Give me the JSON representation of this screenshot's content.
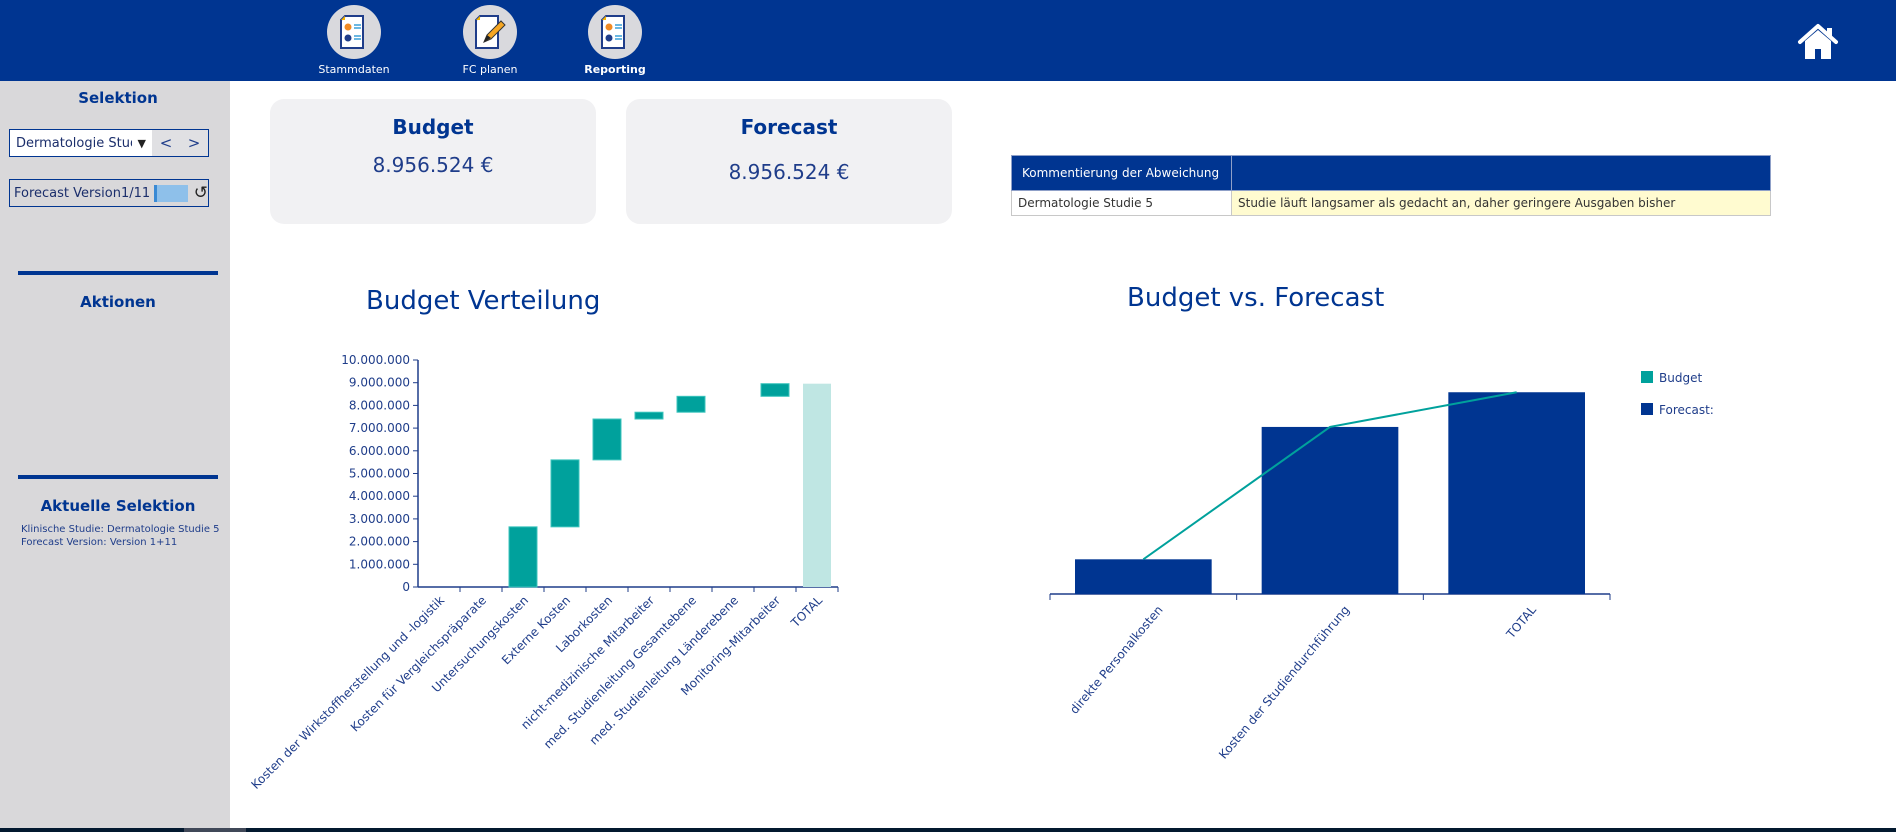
{
  "topnav": {
    "items": [
      {
        "label": "Stammdaten",
        "icon": "report-document-icon",
        "active": false
      },
      {
        "label": "FC planen",
        "icon": "edit-document-icon",
        "active": false
      },
      {
        "label": "Reporting",
        "icon": "report-document-icon",
        "active": true
      }
    ],
    "home_icon": "home-icon"
  },
  "sidebar": {
    "selektion_title": "Selektion",
    "study_dropdown": {
      "value": "Dermatologie Studie",
      "prev": "<",
      "next": ">"
    },
    "version_selector": {
      "label": "Forecast Version",
      "value": "1/11"
    },
    "aktionen_title": "Aktionen",
    "aktuelle_selektion_title": "Aktuelle Selektion",
    "aktuelle_selektion_lines": [
      "Klinische Studie: Dermatologie Studie 5",
      "Forecast Version: Version 1+11"
    ]
  },
  "kpis": {
    "budget": {
      "title": "Budget",
      "value": "8.956.524 €"
    },
    "forecast": {
      "title": "Forecast",
      "value": "8.956.524 €"
    }
  },
  "comment_table": {
    "header": [
      "Kommentierung der Abweichung",
      ""
    ],
    "rows": [
      [
        "Dermatologie Studie 5",
        "Studie läuft langsamer als gedacht an, daher geringere Ausgaben bisher"
      ]
    ]
  },
  "colors": {
    "navy": "#003591",
    "teal": "#00a19c",
    "total_teal": "#bfe6e3"
  },
  "chart_data": [
    {
      "type": "bar",
      "subtype": "waterfall",
      "title": "Budget Verteilung",
      "xlabel": "",
      "ylabel": "",
      "ylim": [
        0,
        10000000
      ],
      "yticks": [
        0,
        1000000,
        2000000,
        3000000,
        4000000,
        5000000,
        6000000,
        7000000,
        8000000,
        9000000,
        10000000
      ],
      "ytick_labels": [
        "0",
        "1.000.000",
        "2.000.000",
        "3.000.000",
        "4.000.000",
        "5.000.000",
        "6.000.000",
        "7.000.000",
        "8.000.000",
        "9.000.000",
        "10.000.000"
      ],
      "categories": [
        "Kosten der Wirkstoffherstellung und -logistik",
        "Kosten für Vergleichspräparate",
        "Untersuchungskosten",
        "Externe Kosten",
        "Laborkosten",
        "nicht-medizinische Mitarbeiter",
        "med. Studienleitung Gesamtebene",
        "med. Studienleitung Länderebene",
        "Monitoring-Mitarbeiter",
        "TOTAL"
      ],
      "values": [
        0,
        0,
        2650000,
        2950000,
        1800000,
        300000,
        700000,
        0,
        556524,
        8956524
      ],
      "is_total": [
        false,
        false,
        false,
        false,
        false,
        false,
        false,
        false,
        false,
        true
      ],
      "grid": false,
      "legend": "none"
    },
    {
      "type": "bar",
      "title": "Budget vs. Forecast",
      "categories": [
        "direkte Personalkosten",
        "Kosten der Studiendurchführung",
        "TOTAL"
      ],
      "series": [
        {
          "name": "Budget",
          "kind": "line",
          "values": [
            1540000,
            7416524,
            8956524
          ]
        },
        {
          "name": "Forecast:",
          "kind": "bar",
          "values": [
            1540000,
            7416524,
            8956524
          ]
        }
      ],
      "ylim": [
        0,
        9500000
      ],
      "grid": false,
      "legend": "top-right"
    }
  ]
}
